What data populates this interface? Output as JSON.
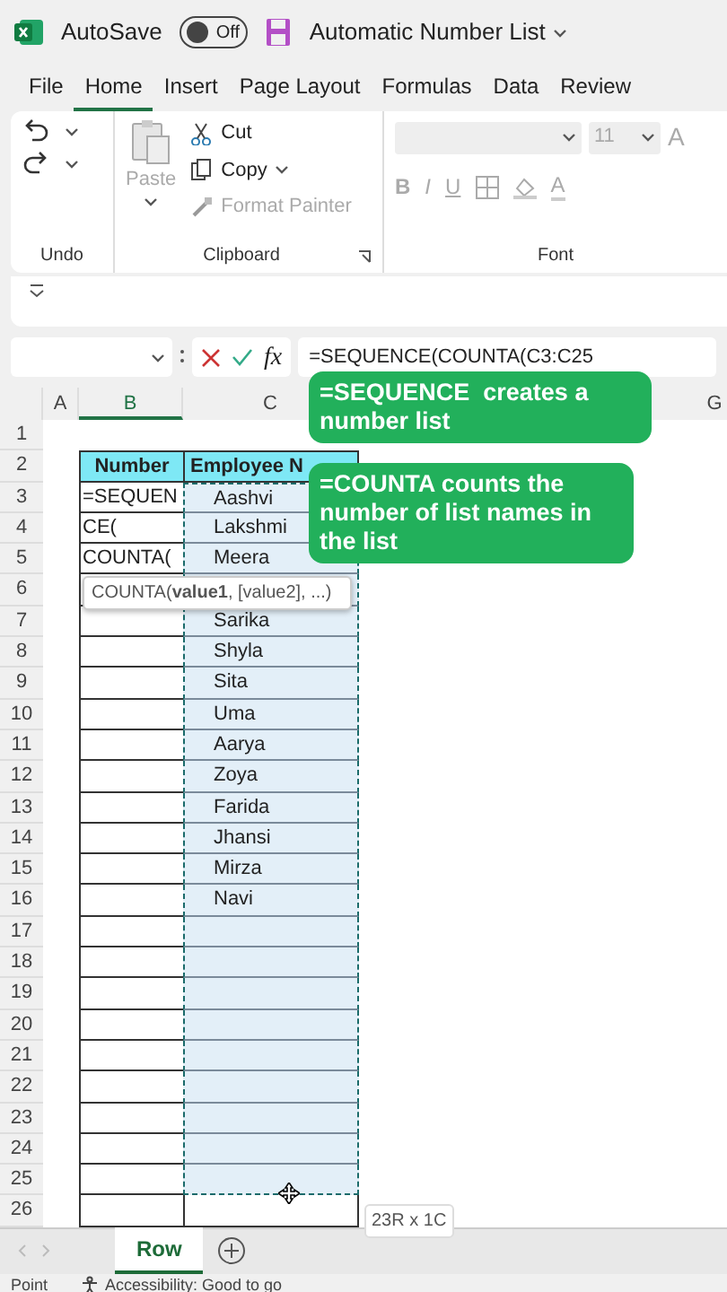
{
  "title_bar": {
    "autosave_label": "AutoSave",
    "autosave": {
      "on": false,
      "label": "Off"
    },
    "document_title": "Automatic Number List"
  },
  "menu_tabs": [
    {
      "label": "File",
      "selected": false
    },
    {
      "label": "Home",
      "selected": true
    },
    {
      "label": "Insert",
      "selected": false
    },
    {
      "label": "Page Layout",
      "selected": false
    },
    {
      "label": "Formulas",
      "selected": false
    },
    {
      "label": "Data",
      "selected": false
    },
    {
      "label": "Review",
      "selected": false
    }
  ],
  "ribbon": {
    "undo": {
      "label": "Undo"
    },
    "clipboard": {
      "label": "Clipboard",
      "paste": {
        "label": "Paste",
        "disabled": true
      },
      "items": [
        {
          "label": "Cut",
          "disabled": false,
          "kind": "cut"
        },
        {
          "label": "Copy",
          "disabled": false,
          "kind": "copy"
        },
        {
          "label": "Format Painter",
          "disabled": true,
          "kind": "painter"
        }
      ]
    },
    "font": {
      "label": "Font",
      "size": "11",
      "grow": "A",
      "styles": [
        {
          "label": "B",
          "kind": "bold"
        },
        {
          "label": "I",
          "kind": "italic"
        },
        {
          "label": "U",
          "kind": "underline"
        }
      ],
      "color_label": "A"
    }
  },
  "formula_bar": {
    "fx": "fx",
    "formula": "=SEQUENCE(COUNTA(C3:C25"
  },
  "columns": [
    {
      "label": "A",
      "selected": false
    },
    {
      "label": "B",
      "selected": true
    },
    {
      "label": "C",
      "selected": false
    },
    {
      "label": "G",
      "selected": false
    }
  ],
  "rows": [
    {
      "number": "1",
      "kind": "blank"
    },
    {
      "number": "2",
      "kind": "header",
      "b": "Number",
      "c": "Employee N"
    },
    {
      "number": "3",
      "kind": "data",
      "b": "=SEQUEN",
      "c": "Aashvi",
      "selected": true
    },
    {
      "number": "4",
      "kind": "data",
      "b": "CE(",
      "c": "Lakshmi",
      "selected": true
    },
    {
      "number": "5",
      "kind": "data",
      "b": "COUNTA(",
      "c": "Meera",
      "selected": true
    },
    {
      "number": "6",
      "kind": "data",
      "selected": true
    },
    {
      "number": "7",
      "kind": "data",
      "c": "Sarika",
      "selected": true
    },
    {
      "number": "8",
      "kind": "data",
      "c": "Shyla",
      "selected": true
    },
    {
      "number": "9",
      "kind": "data",
      "c": "Sita",
      "selected": true
    },
    {
      "number": "10",
      "kind": "data",
      "c": "Uma",
      "selected": true
    },
    {
      "number": "11",
      "kind": "data",
      "c": "Aarya",
      "selected": true
    },
    {
      "number": "12",
      "kind": "data",
      "c": "Zoya",
      "selected": true
    },
    {
      "number": "13",
      "kind": "data",
      "c": "Farida",
      "selected": true
    },
    {
      "number": "14",
      "kind": "data",
      "c": "Jhansi",
      "selected": true
    },
    {
      "number": "15",
      "kind": "data",
      "c": "Mirza",
      "selected": true
    },
    {
      "number": "16",
      "kind": "data",
      "c": "Navi",
      "selected": true
    },
    {
      "number": "17",
      "kind": "data",
      "selected": true
    },
    {
      "number": "18",
      "kind": "data",
      "selected": true
    },
    {
      "number": "19",
      "kind": "data",
      "selected": true
    },
    {
      "number": "20",
      "kind": "data",
      "selected": true
    },
    {
      "number": "21",
      "kind": "data",
      "selected": true
    },
    {
      "number": "22",
      "kind": "data",
      "selected": true
    },
    {
      "number": "23",
      "kind": "data",
      "selected": true
    },
    {
      "number": "24",
      "kind": "data",
      "selected": true
    },
    {
      "number": "25",
      "kind": "data",
      "selected": true
    },
    {
      "number": "26",
      "kind": "data",
      "selected": false
    }
  ],
  "tooltip": "COUNTA(**value1**, [value2], ...)",
  "selection_size": "23R x 1C",
  "callouts": [
    "=SEQUENCE  creates a number list",
    "=COUNTA counts the number of list names in the list"
  ],
  "sheet_tabs": [
    {
      "label": "Row",
      "selected": true
    }
  ],
  "status_bar": {
    "mode": "Point",
    "accessibility": "Accessibility: Good to go"
  }
}
